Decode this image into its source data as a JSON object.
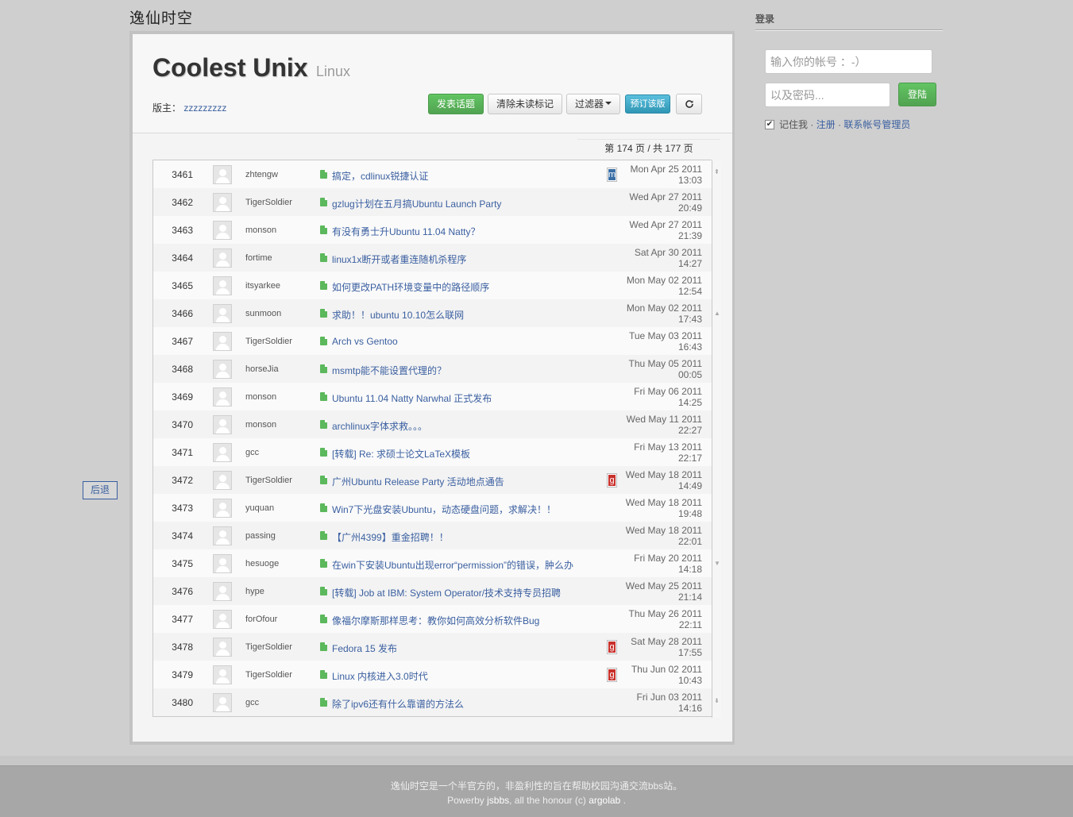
{
  "site": {
    "title": "逸仙时空"
  },
  "board": {
    "name": "Coolest Unix",
    "subname": "Linux",
    "moderator_label": "版主：",
    "moderator": "zzzzzzzzz"
  },
  "toolbar": {
    "post": "发表话题",
    "clear_unread": "清除未读标记",
    "filter": "过滤器",
    "subscribe": "预订该版",
    "refresh_icon": "refresh-icon"
  },
  "pager": {
    "text": "第 174 页 / 共 177 页"
  },
  "topics": [
    {
      "num": "3461",
      "author": "zhtengw",
      "title": "搞定，cdlinux锐捷认证",
      "mark": "m",
      "date1": "Mon Apr 25 2011",
      "date2": "13:03"
    },
    {
      "num": "3462",
      "author": "TigerSoldier",
      "title": "gzlug计划在五月搞Ubuntu Launch Party",
      "mark": "",
      "date1": "Wed Apr 27 2011",
      "date2": "20:49"
    },
    {
      "num": "3463",
      "author": "monson",
      "title": "有没有勇士升Ubuntu 11.04 Natty？",
      "mark": "",
      "date1": "Wed Apr 27 2011",
      "date2": "21:39"
    },
    {
      "num": "3464",
      "author": "fortime",
      "title": "linux1x断开或者重连随机杀程序",
      "mark": "",
      "date1": "Sat Apr 30 2011",
      "date2": "14:27"
    },
    {
      "num": "3465",
      "author": "itsyarkee",
      "title": "如何更改PATH环境变量中的路径顺序",
      "mark": "",
      "date1": "Mon May 02 2011",
      "date2": "12:54"
    },
    {
      "num": "3466",
      "author": "sunmoon",
      "title": "求助！！ubuntu 10.10怎么联网",
      "mark": "",
      "date1": "Mon May 02 2011",
      "date2": "17:43"
    },
    {
      "num": "3467",
      "author": "TigerSoldier",
      "title": "Arch vs Gentoo",
      "mark": "",
      "date1": "Tue May 03 2011",
      "date2": "16:43"
    },
    {
      "num": "3468",
      "author": "horseJia",
      "title": "msmtp能不能设置代理的？",
      "mark": "",
      "date1": "Thu May 05 2011",
      "date2": "00:05"
    },
    {
      "num": "3469",
      "author": "monson",
      "title": "Ubuntu 11.04 Natty Narwhal 正式发布",
      "mark": "",
      "date1": "Fri May 06 2011",
      "date2": "14:25"
    },
    {
      "num": "3470",
      "author": "monson",
      "title": "archlinux字体求救。。。",
      "mark": "",
      "date1": "Wed May 11 2011",
      "date2": "22:27"
    },
    {
      "num": "3471",
      "author": "gcc",
      "title": "[转载] Re: 求硕士论文LaTeX模板",
      "mark": "",
      "date1": "Fri May 13 2011",
      "date2": "22:17"
    },
    {
      "num": "3472",
      "author": "TigerSoldier",
      "title": "广州Ubuntu Release Party 活动地点通告",
      "mark": "g",
      "date1": "Wed May 18 2011",
      "date2": "14:49"
    },
    {
      "num": "3473",
      "author": "yuquan",
      "title": "Win7下光盘安装Ubuntu，动态硬盘问题，求解决！！",
      "mark": "",
      "date1": "Wed May 18 2011",
      "date2": "19:48"
    },
    {
      "num": "3474",
      "author": "passing",
      "title": "【广州4399】重金招聘！！",
      "mark": "",
      "date1": "Wed May 18 2011",
      "date2": "22:01"
    },
    {
      "num": "3475",
      "author": "hesuoge",
      "title": "在win下安装Ubuntu出现error“permission”的错误，肿么办",
      "mark": "",
      "date1": "Fri May 20 2011",
      "date2": "14:18"
    },
    {
      "num": "3476",
      "author": "hype",
      "title": "[转载] Job at IBM: System Operator/技术支持专员招聘",
      "mark": "",
      "date1": "Wed May 25 2011",
      "date2": "21:14"
    },
    {
      "num": "3477",
      "author": "forOfour",
      "title": "像福尔摩斯那样思考：教你如何高效分析软件Bug",
      "mark": "",
      "date1": "Thu May 26 2011",
      "date2": "22:11"
    },
    {
      "num": "3478",
      "author": "TigerSoldier",
      "title": "Fedora 15 发布",
      "mark": "g",
      "date1": "Sat May 28 2011",
      "date2": "17:55"
    },
    {
      "num": "3479",
      "author": "TigerSoldier",
      "title": "Linux 内核进入3.0时代",
      "mark": "g",
      "date1": "Thu Jun 02 2011",
      "date2": "10:43"
    },
    {
      "num": "3480",
      "author": "gcc",
      "title": "除了ipv6还有什么靠谱的方法么",
      "mark": "",
      "date1": "Fri Jun 03 2011",
      "date2": "14:16"
    }
  ],
  "nav": {
    "back": "后退"
  },
  "login": {
    "heading": "登录",
    "username_placeholder": "输入你的帐号 ：-）",
    "password_placeholder": "以及密码...",
    "submit": "登陆",
    "remember": "记住我",
    "sep1": "·",
    "register": "注册",
    "sep2": "·",
    "contact_admin": "联系帐号管理员"
  },
  "footer": {
    "line1": "逸仙时空是一个半官方的，非盈利性的旨在帮助校园沟通交流bbs站。",
    "powered_prefix": "Powerby",
    "powered_by": "jsbbs",
    "honour_text": ",   all the honour (c)",
    "honour_link": "argolab",
    "end": "."
  },
  "colors": {
    "link": "#3a5fa0",
    "green": "#5cb85c",
    "mark_m": "#3a6ea5",
    "mark_g": "#c9302c"
  }
}
